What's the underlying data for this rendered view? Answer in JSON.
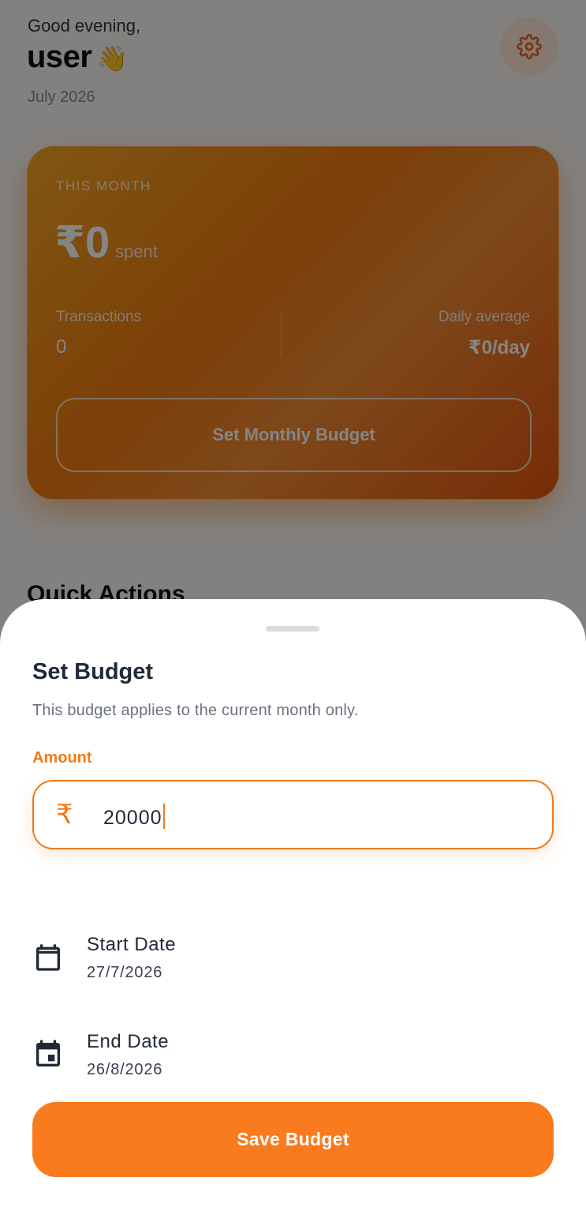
{
  "header": {
    "greeting": "Good evening,",
    "username": "user",
    "wave_emoji": "👋",
    "month": "July 2026",
    "settings_icon": "gear-icon"
  },
  "summary_card": {
    "kicker": "THIS MONTH",
    "amount": "₹0",
    "amount_suffix": "spent",
    "transactions_label": "Transactions",
    "transactions_value": "0",
    "daily_avg_label": "Daily average",
    "daily_avg_value": "₹0/day",
    "set_budget_label": "Set Monthly Budget"
  },
  "quick_actions_title": "Quick Actions",
  "sheet": {
    "title": "Set Budget",
    "subtitle": "This budget applies to the current month only.",
    "amount_label": "Amount",
    "currency_symbol": "₹",
    "amount_value": "20000",
    "start_date_label": "Start Date",
    "start_date_value": "27/7/2026",
    "end_date_label": "End Date",
    "end_date_value": "26/8/2026",
    "save_label": "Save Budget"
  },
  "colors": {
    "accent": "#f97b1d",
    "text_dark": "#1f2937",
    "text_muted": "#6b7280"
  }
}
